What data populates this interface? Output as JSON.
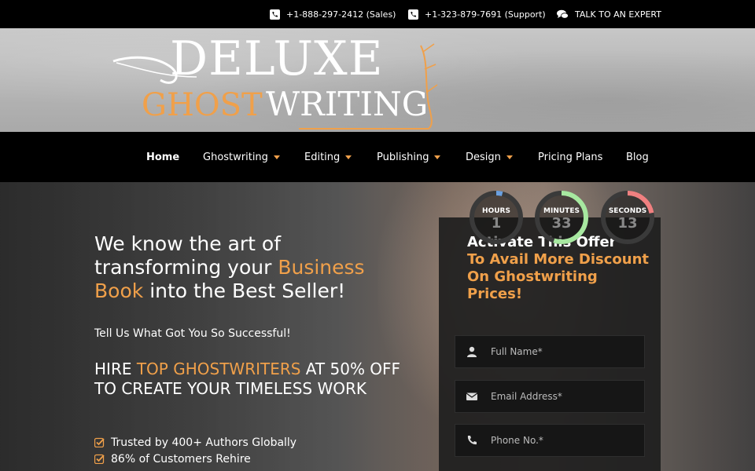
{
  "topbar": {
    "sales": "+1-888-297-2412 (Sales)",
    "support": "+1-323-879-7691 (Support)",
    "expert": "TALK TO AN EXPERT",
    "icons": [
      "phone-icon",
      "phone-icon",
      "chat-icon"
    ]
  },
  "logo": {
    "line1": "DELUXE",
    "line2a": "GHOST",
    "line2b": "WRITING"
  },
  "nav": {
    "items": [
      {
        "label": "Home",
        "dropdown": false
      },
      {
        "label": "Ghostwriting",
        "dropdown": true
      },
      {
        "label": "Editing",
        "dropdown": true
      },
      {
        "label": "Publishing",
        "dropdown": true
      },
      {
        "label": "Design",
        "dropdown": true
      },
      {
        "label": "Pricing Plans",
        "dropdown": false
      },
      {
        "label": "Blog",
        "dropdown": false
      }
    ]
  },
  "hero": {
    "headline_1": "We know the art of transforming your",
    "headline_highlight": "Business Book",
    "headline_2": "into the Best Seller!",
    "subline": "Tell Us What Got You So Successful!",
    "hire_1": "HIRE",
    "hire_highlight": "TOP GHOSTWRITERS",
    "hire_2": "AT 50% OFF",
    "hire_3": "TO CREATE YOUR TIMELESS WORK",
    "bullets": [
      "Trusted by 400+ Authors Globally",
      "86% of Customers Rehire"
    ]
  },
  "countdown": {
    "hours": {
      "label": "HOURS",
      "value": "1",
      "fraction": 0.04,
      "color": "#6aa0e0"
    },
    "minutes": {
      "label": "MINUTES",
      "value": "33",
      "fraction": 0.55,
      "color": "#a7e8a0"
    },
    "seconds": {
      "label": "SECONDS",
      "value": "13",
      "fraction": 0.22,
      "color": "#f08080"
    }
  },
  "form": {
    "title_1": "Activate This Offer",
    "title_2": "To Avail More Discount",
    "title_3": "On Ghostwriting Prices!",
    "name_placeholder": "Full Name*",
    "email_placeholder": "Email Address*",
    "phone_placeholder": "Phone No.*"
  },
  "colors": {
    "accent": "#f0a04a",
    "nav_bg": "#000000"
  }
}
